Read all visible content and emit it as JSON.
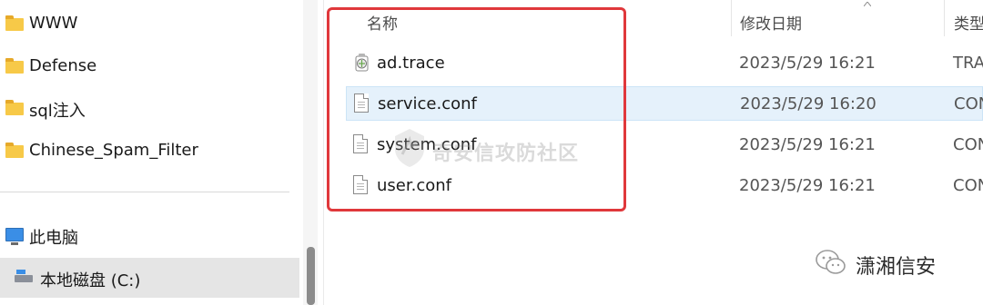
{
  "nav": {
    "folders": [
      {
        "label": "WWW",
        "icon": "folder-icon"
      },
      {
        "label": "Defense",
        "icon": "folder-icon"
      },
      {
        "label": "sql注入",
        "icon": "folder-icon"
      },
      {
        "label": "Chinese_Spam_Filter",
        "icon": "folder-icon"
      }
    ],
    "this_pc": {
      "label": "此电脑",
      "icon": "computer-icon"
    },
    "drive": {
      "label": "本地磁盘 (C:)",
      "icon": "drive-icon"
    }
  },
  "columns": {
    "name": "名称",
    "modified": "修改日期",
    "type": "类型"
  },
  "files": [
    {
      "name": "ad.trace",
      "modified": "2023/5/29 16:21",
      "type": "TRA",
      "icon": "trace-file-icon",
      "selected": false
    },
    {
      "name": "service.conf",
      "modified": "2023/5/29 16:20",
      "type": "CON",
      "icon": "document-icon",
      "selected": true
    },
    {
      "name": "system.conf",
      "modified": "2023/5/29 16:21",
      "type": "CON",
      "icon": "document-icon",
      "selected": false
    },
    {
      "name": "user.conf",
      "modified": "2023/5/29 16:21",
      "type": "CON",
      "icon": "document-icon",
      "selected": false
    }
  ],
  "watermark": "奇安信攻防社区",
  "brand": {
    "text": "潇湘信安",
    "icon": "wechat-icon"
  },
  "colors": {
    "highlight": "#e0383b",
    "selection": "#e5f1fb",
    "folder": "#f7c948"
  }
}
